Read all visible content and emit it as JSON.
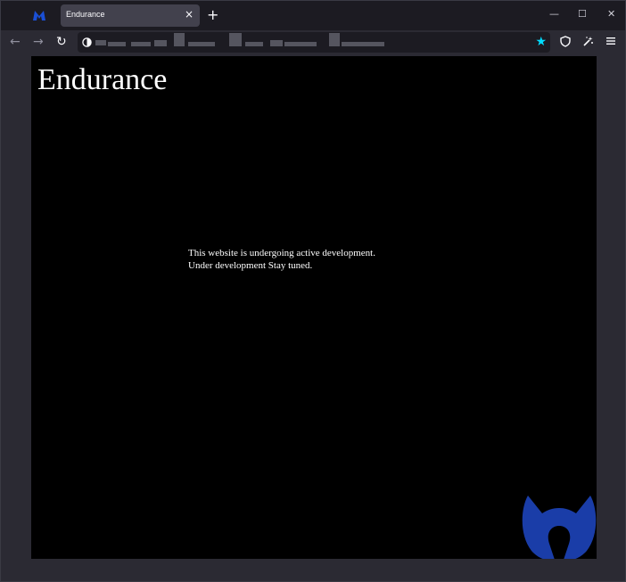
{
  "browser": {
    "tab": {
      "title": "Endurance",
      "close_glyph": "×"
    },
    "new_tab_glyph": "+",
    "window_controls": {
      "minimize": "—",
      "maximize": "☐",
      "close": "✕"
    },
    "nav": {
      "back": "←",
      "forward": "→",
      "reload": "↻"
    },
    "address_bar": {
      "url": ""
    },
    "icons": [
      "malwarebytes-logo-icon",
      "shield-icon",
      "bookmark-star-icon",
      "extension-icon",
      "menu-icon"
    ],
    "accent_color": "#00ddff",
    "logo_color": "#1a3da8"
  },
  "page": {
    "heading": "Endurance",
    "message_line1": "This website is undergoing active development.",
    "message_line2": "Under development Stay tuned."
  }
}
